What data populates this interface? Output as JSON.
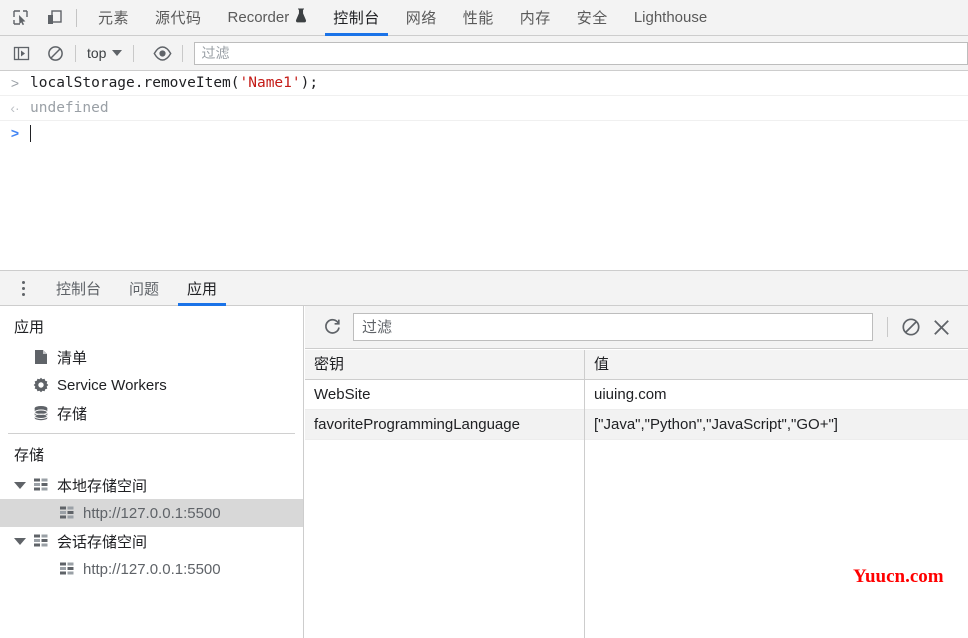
{
  "colors": {
    "accent": "#1a73e8",
    "toolbar_bg": "#f3f3f3",
    "border": "#cdcdcd",
    "selected_row": "#d8d8d8",
    "string_literal": "#c41a16",
    "watermark": "#ff0000"
  },
  "devtools_tabbar": {
    "icons": [
      {
        "name": "inspect-element-icon",
        "label": "Inspect"
      },
      {
        "name": "device-toolbar-icon",
        "label": "Toggle device toolbar"
      }
    ],
    "tabs": [
      {
        "label": "元素",
        "active": false
      },
      {
        "label": "源代码",
        "active": false
      },
      {
        "label": "Recorder",
        "active": false,
        "icon": "flask-icon"
      },
      {
        "label": "控制台",
        "active": true
      },
      {
        "label": "网络",
        "active": false
      },
      {
        "label": "性能",
        "active": false
      },
      {
        "label": "内存",
        "active": false
      },
      {
        "label": "安全",
        "active": false
      },
      {
        "label": "Lighthouse",
        "active": false
      }
    ]
  },
  "console_toolbar": {
    "sidebar_toggle": "console-sidebar-icon",
    "clear_console": "clear-console-icon",
    "context": "top",
    "eye": "live-expression-icon",
    "filter_placeholder": "过滤",
    "filter_value": ""
  },
  "console": {
    "messages": [
      {
        "gutter": ">",
        "type": "input",
        "code_pre": "localStorage.removeItem(",
        "code_str": "'Name1'",
        "code_post": ");"
      },
      {
        "gutter": "‹·",
        "type": "output",
        "text": "undefined"
      }
    ],
    "prompt_gutter": ">"
  },
  "drawer": {
    "menu_icon": "drawer-menu-icon",
    "tabs": [
      {
        "label": "控制台",
        "active": false
      },
      {
        "label": "问题",
        "active": false
      },
      {
        "label": "应用",
        "active": true
      }
    ]
  },
  "app_sidebar": {
    "application": {
      "title": "应用",
      "items": [
        {
          "label": "清单",
          "icon": "manifest-document-icon"
        },
        {
          "label": "Service Workers",
          "icon": "gear-icon"
        },
        {
          "label": "存储",
          "icon": "database-stack-icon"
        }
      ]
    },
    "storage": {
      "title": "存储",
      "trees": [
        {
          "label": "本地存储空间",
          "icon": "table-grid-icon",
          "expanded": true,
          "children": [
            {
              "label": "http://127.0.0.1:5500",
              "icon": "table-grid-icon",
              "selected": true
            }
          ]
        },
        {
          "label": "会话存储空间",
          "icon": "table-grid-icon",
          "expanded": true,
          "children": [
            {
              "label": "http://127.0.0.1:5500",
              "icon": "table-grid-icon",
              "selected": false
            }
          ]
        }
      ]
    }
  },
  "storage_toolbar": {
    "refresh_icon": "refresh-icon",
    "filter_placeholder": "过滤",
    "filter_value": "",
    "clear_all_icon": "clear-all-icon",
    "delete_selected_icon": "close-x-icon"
  },
  "storage_table": {
    "columns": [
      "密钥",
      "值"
    ],
    "rows": [
      {
        "key": "WebSite",
        "value": "uiuing.com"
      },
      {
        "key": "favoriteProgrammingLanguage",
        "value": "[\"Java\",\"Python\",\"JavaScript\",\"GO+\"]"
      }
    ]
  },
  "watermark": {
    "text": "Yuucn.com"
  }
}
